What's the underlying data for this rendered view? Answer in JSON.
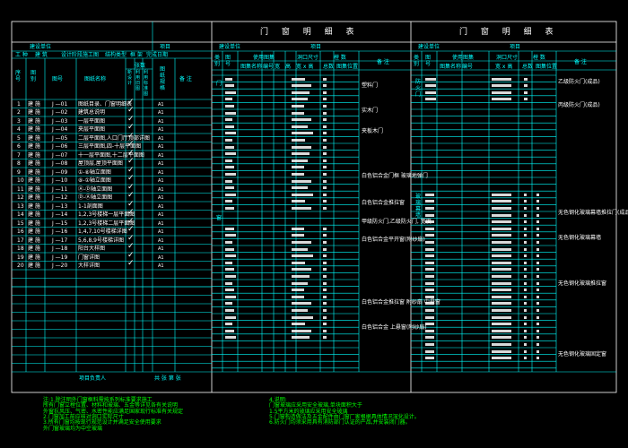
{
  "drawing_list": {
    "header": {
      "unit_label": "建设单位",
      "project_label": "项目",
      "row2": [
        "工 种",
        "建 筑",
        "设计阶段",
        "施工图",
        "结构类型",
        "框 架",
        "完成日期"
      ],
      "col_no": "序号",
      "col_type": "图别",
      "col_num": "图号",
      "col_name": "图纸名称",
      "col_count": "张数",
      "col_count_sub": [
        "新设计",
        "利用旧图",
        "利用标准图"
      ],
      "col_size": "图纸规格",
      "col_note": "备 注"
    },
    "rows": [
      {
        "no": "1",
        "type": "建 施",
        "num": "J —01",
        "name": "图纸目录、门窗明细表",
        "size": "A1",
        "check": "✓"
      },
      {
        "no": "2",
        "type": "建 施",
        "num": "J —02",
        "name": "建筑总说明",
        "size": "A1",
        "check": "✓"
      },
      {
        "no": "3",
        "type": "建 施",
        "num": "J —03",
        "name": "一层平面图",
        "size": "A1",
        "check": "✓"
      },
      {
        "no": "4",
        "type": "建 施",
        "num": "J —04",
        "name": "夹层平面图",
        "size": "A1",
        "check": "✓"
      },
      {
        "no": "5",
        "type": "建 施",
        "num": "J —05",
        "name": "二层平面图,人口门厅顶部详图",
        "size": "A1",
        "check": "✓"
      },
      {
        "no": "6",
        "type": "建 施",
        "num": "J —06",
        "name": "三层平面图,四-十层平面图",
        "size": "A1",
        "check": "✓"
      },
      {
        "no": "7",
        "type": "建 施",
        "num": "J —07",
        "name": "十一层平面图,十二层平面图",
        "size": "A1",
        "check": "✓"
      },
      {
        "no": "8",
        "type": "建 施",
        "num": "J —08",
        "name": "屋顶层,屋顶平面图",
        "size": "A1",
        "check": "✓"
      },
      {
        "no": "9",
        "type": "建 施",
        "num": "J —09",
        "name": "①-⑧轴立面图",
        "size": "A1",
        "check": "✓"
      },
      {
        "no": "10",
        "type": "建 施",
        "num": "J —10",
        "name": "⑧-①轴立面图",
        "size": "A1",
        "check": "✓"
      },
      {
        "no": "11",
        "type": "建 施",
        "num": "J —11",
        "name": "Ⓐ-Ⓓ轴立面图",
        "size": "A1",
        "check": "✓"
      },
      {
        "no": "12",
        "type": "建 施",
        "num": "J —12",
        "name": "Ⓓ-Ⓐ轴立面图",
        "size": "A1",
        "check": "✓"
      },
      {
        "no": "13",
        "type": "建 施",
        "num": "J —13",
        "name": "1-1剖面图",
        "size": "A1",
        "check": "✓"
      },
      {
        "no": "14",
        "type": "建 施",
        "num": "J —14",
        "name": "1,2,3号楼梯一层平面图",
        "size": "A1",
        "check": "✓"
      },
      {
        "no": "15",
        "type": "建 施",
        "num": "J —15",
        "name": "1,2,3号楼梯二层平面图",
        "size": "A1",
        "check": "✓"
      },
      {
        "no": "16",
        "type": "建 施",
        "num": "J —16",
        "name": "1,4,7,10号楼梯详图",
        "size": "A1",
        "check": "✓"
      },
      {
        "no": "17",
        "type": "建 施",
        "num": "J —17",
        "name": "5,6,8,9号楼梯详图",
        "size": "A1",
        "check": "✓"
      },
      {
        "no": "18",
        "type": "建 施",
        "num": "J —18",
        "name": "阳台大样图",
        "size": "A1",
        "check": "✓"
      },
      {
        "no": "19",
        "type": "建 施",
        "num": "J —19",
        "name": "门窗详图",
        "size": "A1",
        "check": "✓"
      },
      {
        "no": "20",
        "type": "建 施",
        "num": "J —20",
        "name": "大样详图",
        "size": "A1",
        "check": "✓"
      }
    ],
    "footer": {
      "person": "项目负责人",
      "total": "共  张  第  张"
    }
  },
  "door_table_1": {
    "title": "门 窗 明 细 表",
    "unit_label": "建设单位",
    "project_label": "项目",
    "headers": {
      "cat": "类别",
      "num": "图号",
      "use_label": "使用图集",
      "size_label": "洞口尺寸",
      "count_label": "樘 数",
      "sub": [
        "图集名称",
        "编号",
        "宽",
        "高",
        "宽 x 高",
        "总数",
        "图集位置",
        "备 注"
      ]
    },
    "category_door": "门",
    "category_window": "窗",
    "notes": [
      "塑料门",
      "实木门",
      "夹板木门",
      "白色铝合金门框 玻璃地弹门",
      "白色铝合金推拉窗",
      "甲级防火门,乙级防火门,    宽度",
      "白色铝合金平开窗(附纱扇)",
      "白色铝合金推拉窗 附纱扇 中悬窗",
      "白色铝合金 上悬窗(附纱扇)"
    ]
  },
  "door_table_2": {
    "title": "门 窗 明 细 表",
    "cat_fire": "防火门",
    "cat_curtain": "玻璃幕墙",
    "notes": [
      "乙级防火门(成品)",
      "丙级防火门(成品)",
      "无色钢化玻璃幕墙推拉门(成品)",
      "无色钢化玻璃幕墙",
      "无色钢化玻璃推拉窗",
      "无色钢化玻璃固定窗"
    ]
  },
  "notes": {
    "left": [
      "注:1.除注明外门窗框料需按系列标准要求施工",
      "    所有门窗立樘位置、材料和玻璃、五金等详见各有关说明",
      "    外窗抗风压、气密、水密性能应满足国家现行标准有关规定",
      "    2.门窗加工前应核对洞口实际尺寸",
      "    3.所有门窗均按现行规范设计并满足安全使用要求",
      "    外门窗玻璃均为中空玻璃"
    ],
    "right": [
      "4.说明:",
      "    门窗玻璃应采用安全玻璃,单块面积大于",
      "    1.5平方米的玻璃应采用安全玻璃",
      "5.门窗构造做法及五金配件由门窗厂家根据具体情况深化设计。",
      "6.防火门均须采用具有消防部门认证的产品,并安装闭门器。"
    ]
  }
}
